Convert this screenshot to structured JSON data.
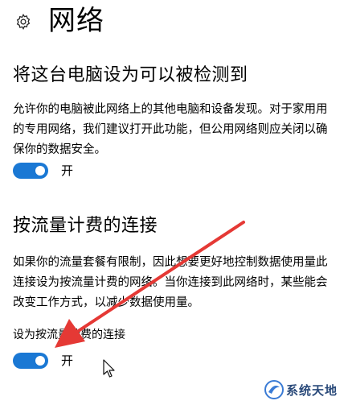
{
  "header": {
    "title": "网络"
  },
  "discoverable": {
    "heading": "将这台电脑设为可以被检测到",
    "description": "允许你的电脑被此网络上的其他电脑和设备发现。对于家用用的专用网络，我们建议打开此功能，但公用网络则应关闭以确保你的数据安全。",
    "toggle_state": "开"
  },
  "metered": {
    "heading": "按流量计费的连接",
    "description": "如果你的流量套餐有限制，因此想要更好地控制数据使用量此连接设为按流量计费的网络。当你连接到此网络时，某些能会改变工作方式，以减少数据使用量。",
    "setting_label": "设为按流量计费的连接",
    "toggle_state": "开"
  },
  "watermark": {
    "text": "系统天地"
  },
  "colors": {
    "accent": "#1a78d4",
    "annotation_arrow": "#e53935"
  },
  "icons": {
    "settings": "gear-icon",
    "pointer": "mouse-cursor-icon"
  }
}
